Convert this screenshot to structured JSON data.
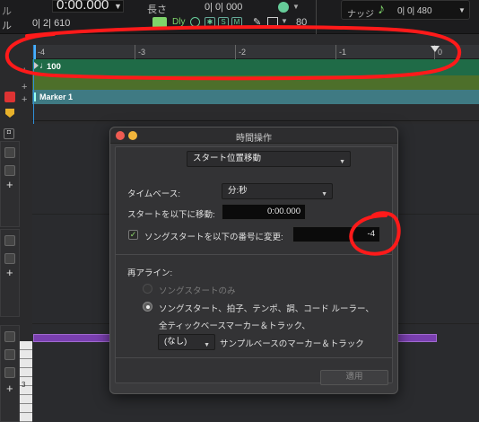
{
  "topbar": {
    "left_small": "ル",
    "position_values": "0| 2| 610",
    "main_time": "0:00.000",
    "length_label": "長さ",
    "length_value": "0| 0| 000",
    "dly_label": "Dly",
    "s_label": "S",
    "m_label": "M",
    "value_80": "80",
    "nudge_label": "ナッジ",
    "nudge_value": "0| 0| 480"
  },
  "ruler": {
    "labels": [
      "-4",
      "-3",
      "-2",
      "-1",
      "0"
    ]
  },
  "tracks": {
    "tempo_value": "100",
    "marker_name": "Marker 1",
    "audio_label": "3"
  },
  "dialog": {
    "title": "時間操作",
    "operation": "スタート位置移動",
    "timebase_label": "タイムベース:",
    "timebase_value": "分:秒",
    "move_start_label": "スタートを以下に移動:",
    "move_start_value": "0:00.000",
    "song_start_check_label": "ソングスタートを以下の番号に変更:",
    "song_start_checked": true,
    "song_start_value": "-4",
    "realign_label": "再アライン:",
    "radio_song_start_only": "ソングスタートのみ",
    "radio_all_line1": "ソングスタート、拍子、テンポ、調、コード ルーラー、",
    "radio_all_line2": "全ティックベースマーカー＆トラック、",
    "samplebased_select": "(なし)",
    "samplebased_label": "サンプルベースのマーカー＆トラック",
    "apply_button": "適用"
  },
  "colors": {
    "accent_green": "#7fd46a",
    "tempo_track": "#1f6b47",
    "chord_track": "#4d6f2a",
    "marker_track": "#3f7a83",
    "annotation_red": "#ff1a1a",
    "clip_purple": "#7a3fb0"
  }
}
